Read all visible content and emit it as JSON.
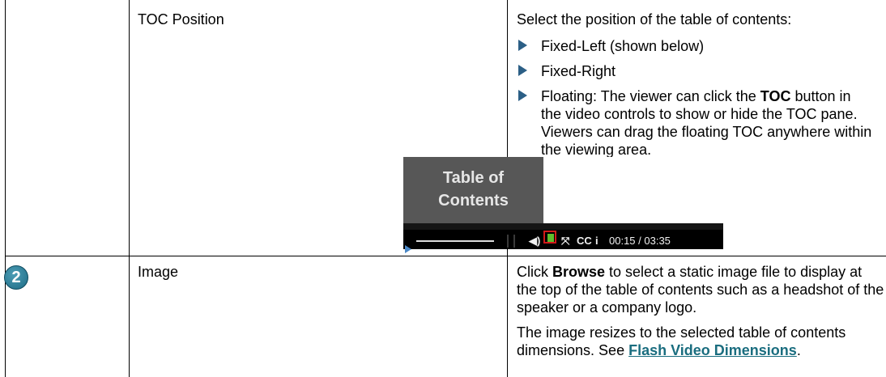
{
  "row1": {
    "label": "TOC Position",
    "intro": "Select the position of the table of contents:",
    "bullets": [
      "Fixed-Left (shown below)",
      "Fixed-Right"
    ],
    "floating_text_pre": "Floating: The viewer can click the ",
    "floating_bold": "TOC",
    "floating_text_post": " button in the video controls to show or hide the TOC pane. Viewers can drag the floating TOC anywhere within the viewing area."
  },
  "screenshot": {
    "toc_title_line1": "Table of",
    "toc_title_line2": "Contents",
    "cc_label": "CC",
    "time": "00:15 / 03:35",
    "icon_names": [
      "play-icon",
      "volume-icon",
      "toc-icon",
      "fullscreen-icon",
      "closed-caption-icon",
      "info-icon"
    ]
  },
  "row2": {
    "step_number": "2",
    "label": "Image",
    "p1_pre": "Click ",
    "p1_bold": "Browse",
    "p1_post": " to select a static image file to display at the top of the table of contents such as a headshot of the speaker or a company logo.",
    "p2_text": "The image resizes to the selected table of contents dimensions. See ",
    "p2_link": "Flash Video Dimensions",
    "p2_end": "."
  },
  "colors": {
    "bullet": "#2c5f86",
    "link": "#1a6d7f",
    "badge": "#1d6b85",
    "highlight_box": "#d21a1a"
  }
}
